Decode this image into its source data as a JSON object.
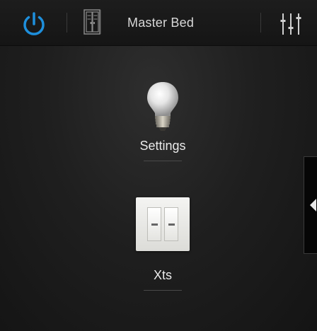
{
  "header": {
    "room_title": "Master Bed",
    "power_icon": "power-icon",
    "room_icon": "room-doors-icon",
    "levels_icon": "sliders-icon",
    "accent_color": "#1e8fdc"
  },
  "devices": [
    {
      "label": "Settings",
      "icon": "light-bulb-icon"
    },
    {
      "label": "Xts",
      "icon": "light-switch-icon"
    }
  ],
  "drawer": {
    "icon": "chevron-left-icon"
  }
}
